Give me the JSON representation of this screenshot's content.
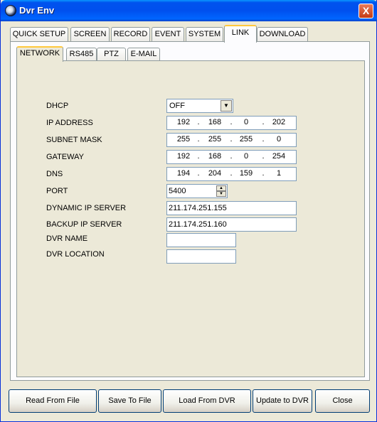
{
  "window": {
    "title": "Dvr Env",
    "close_label": "X"
  },
  "tabs": [
    "QUICK SETUP",
    "SCREEN",
    "RECORD",
    "EVENT",
    "SYSTEM",
    "LINK",
    "DOWNLOAD"
  ],
  "active_tab": "LINK",
  "subtabs": [
    "NETWORK",
    "RS485",
    "PTZ",
    "E-MAIL"
  ],
  "active_subtab": "NETWORK",
  "network": {
    "dhcp": {
      "label": "DHCP",
      "value": "OFF"
    },
    "ip_address": {
      "label": "IP ADDRESS",
      "octets": [
        "192",
        "168",
        "0",
        "202"
      ]
    },
    "subnet_mask": {
      "label": "SUBNET MASK",
      "octets": [
        "255",
        "255",
        "255",
        "0"
      ]
    },
    "gateway": {
      "label": "GATEWAY",
      "octets": [
        "192",
        "168",
        "0",
        "254"
      ]
    },
    "dns": {
      "label": "DNS",
      "octets": [
        "194",
        "204",
        "159",
        "1"
      ]
    },
    "port": {
      "label": "PORT",
      "value": "5400"
    },
    "dynamic_ip_server": {
      "label": "DYNAMIC IP SERVER",
      "value": "211.174.251.155"
    },
    "backup_ip_server": {
      "label": "BACKUP IP SERVER",
      "value": "211.174.251.160"
    },
    "dvr_name": {
      "label": "DVR NAME",
      "value": ""
    },
    "dvr_location": {
      "label": "DVR LOCATION",
      "value": ""
    }
  },
  "buttons": {
    "read_from_file": "Read From File",
    "save_to_file": "Save To File",
    "load_from_dvr": "Load From DVR",
    "update_to_dvr": "Update to DVR",
    "close": "Close"
  }
}
